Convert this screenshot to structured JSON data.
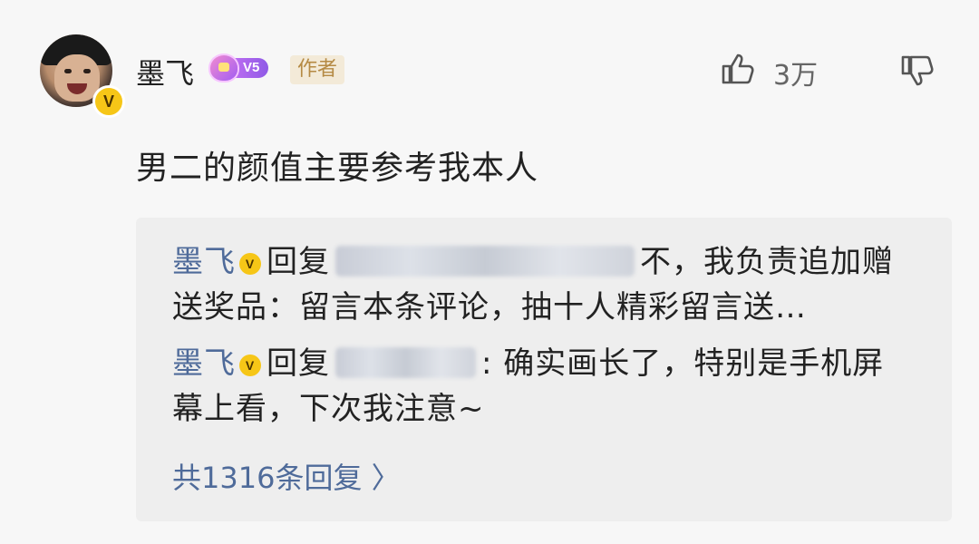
{
  "comment": {
    "username": "墨飞",
    "verified_badge": "V",
    "level": "V5",
    "author_tag": "作者",
    "likes": "3万",
    "text": "男二的颜值主要参考我本人"
  },
  "icons": {
    "like": "thumbs-up-icon",
    "dislike": "thumbs-down-icon"
  },
  "replies": [
    {
      "name": "墨飞",
      "verb": "回复",
      "text": "不，我负责追加赠送奖品：留言本条评论，抽十人精彩留言送…"
    },
    {
      "name": "墨飞",
      "verb": "回复",
      "text": ": 确实画长了，特别是手机屏幕上看，下次我注意~"
    }
  ],
  "more_replies": "共1316条回复 〉"
}
